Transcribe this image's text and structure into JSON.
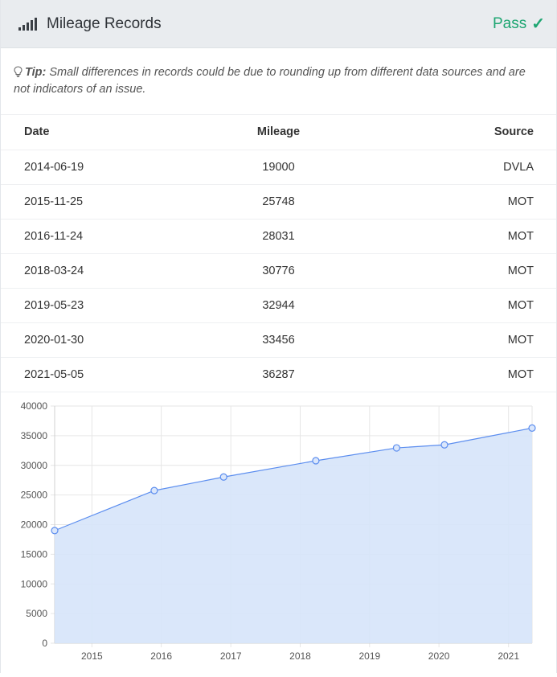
{
  "header": {
    "title": "Mileage Records",
    "status": "Pass",
    "status_color": "#1ea672",
    "icons": {
      "signal": "signal-bars-icon",
      "check": "checkmark-icon"
    }
  },
  "tip": {
    "icon": "lightbulb-icon",
    "label": "Tip:",
    "text": " Small differences in records could be due to rounding up from different data sources and are not indicators of an issue."
  },
  "table": {
    "headers": {
      "date": "Date",
      "mileage": "Mileage",
      "source": "Source"
    },
    "rows": [
      {
        "date": "2014-06-19",
        "mileage": "19000",
        "source": "DVLA"
      },
      {
        "date": "2015-11-25",
        "mileage": "25748",
        "source": "MOT"
      },
      {
        "date": "2016-11-24",
        "mileage": "28031",
        "source": "MOT"
      },
      {
        "date": "2018-03-24",
        "mileage": "30776",
        "source": "MOT"
      },
      {
        "date": "2019-05-23",
        "mileage": "32944",
        "source": "MOT"
      },
      {
        "date": "2020-01-30",
        "mileage": "33456",
        "source": "MOT"
      },
      {
        "date": "2021-05-05",
        "mileage": "36287",
        "source": "MOT"
      }
    ]
  },
  "chart_data": {
    "type": "area",
    "x": [
      "2014-06-19",
      "2015-11-25",
      "2016-11-24",
      "2018-03-24",
      "2019-05-23",
      "2020-01-30",
      "2021-05-05"
    ],
    "series": [
      {
        "values": [
          19000,
          25748,
          28031,
          30776,
          32944,
          33456,
          36287
        ]
      }
    ],
    "xticks": [
      "2015",
      "2016",
      "2017",
      "2018",
      "2019",
      "2020",
      "2021"
    ],
    "yticks": [
      "0",
      "5000",
      "10000",
      "15000",
      "20000",
      "25000",
      "30000",
      "35000",
      "40000"
    ],
    "ylim": [
      0,
      40000
    ],
    "grid": true,
    "line_color": "#5b8def",
    "fill_color": "#d6e4fa"
  }
}
